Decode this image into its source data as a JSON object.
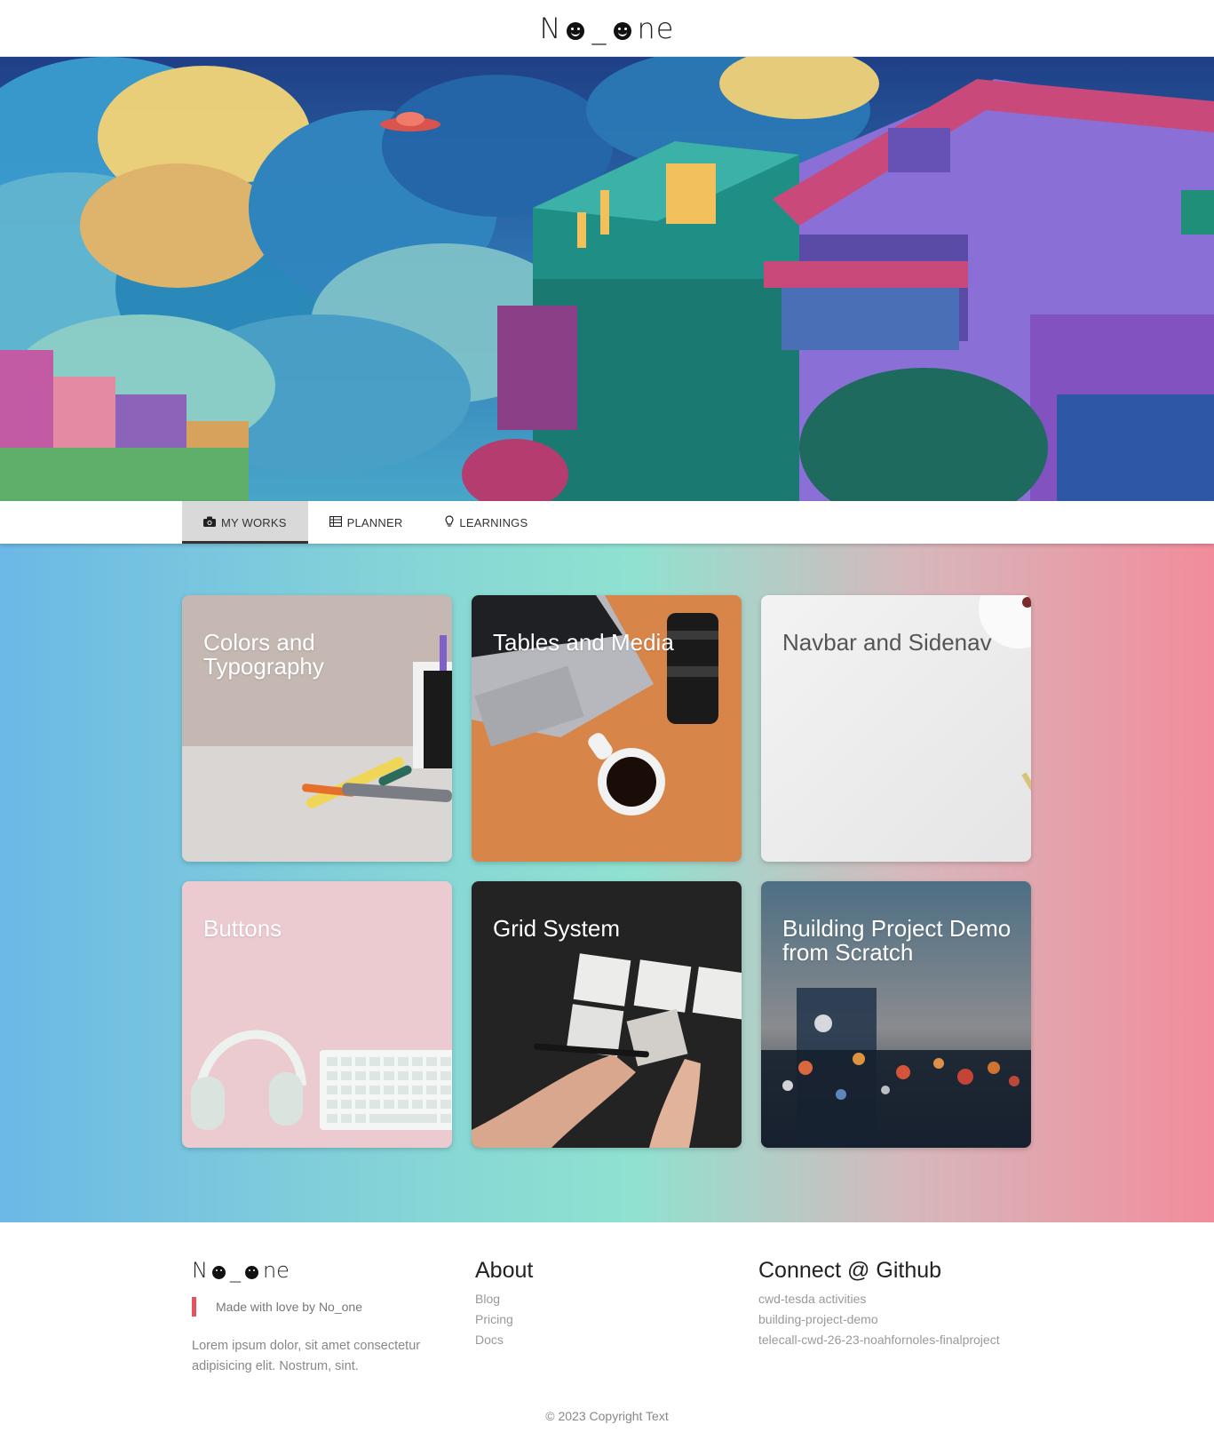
{
  "header": {
    "brand_n": "N",
    "brand_under": "_",
    "brand_ne": "ne"
  },
  "tabs": [
    {
      "label": "MY WORKS",
      "icon": "camera-icon",
      "active": true
    },
    {
      "label": "PLANNER",
      "icon": "table-icon",
      "active": false
    },
    {
      "label": "LEARNINGS",
      "icon": "lightbulb-icon",
      "active": false
    }
  ],
  "cards": [
    {
      "title": "Colors and Typography",
      "image": "pens-on-desk"
    },
    {
      "title": "Tables and Media",
      "image": "laptop-camera-coffee"
    },
    {
      "title": "Navbar and Sidenav",
      "image": "white-desk"
    },
    {
      "title": "Buttons",
      "image": "headphones-keyboard-pink"
    },
    {
      "title": "Grid System",
      "image": "hands-writing-notes"
    },
    {
      "title": "Building Project Demo from Scratch",
      "image": "city-bokeh-dusk"
    }
  ],
  "footer": {
    "brand_n": "N",
    "brand_under": "_",
    "brand_ne": "ne",
    "tagline": "Made with love by No_one",
    "description": "Lorem ipsum dolor, sit amet consectetur adipisicing elit. Nostrum, sint.",
    "about_heading": "About",
    "about_links": [
      "Blog",
      "Pricing",
      "Docs"
    ],
    "connect_heading": "Connect @ Github",
    "connect_links": [
      "cwd-tesda activities",
      "building-project-demo",
      "telecall-cwd-26-23-noahfornoles-finalproject"
    ],
    "copyright": "© 2023 Copyright Text"
  },
  "colors": {
    "accent_red": "#e5535f",
    "gradient_left": "#6cb8e6",
    "gradient_mid": "#8fe2d0",
    "gradient_right": "#f28c9c"
  }
}
